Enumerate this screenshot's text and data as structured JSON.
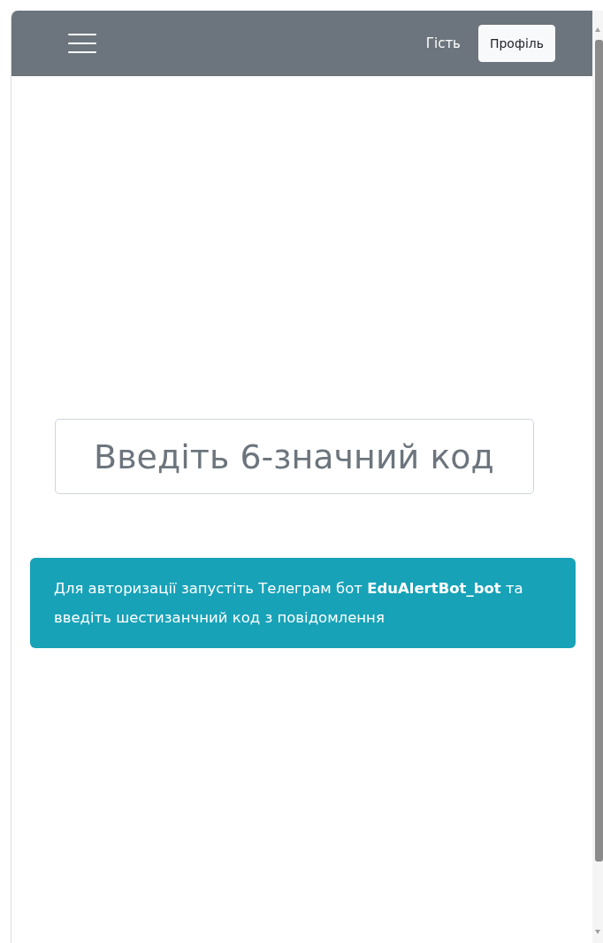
{
  "navbar": {
    "user_label": "Гість",
    "profile_button": "Профіль"
  },
  "code_field": {
    "placeholder": "Введіть 6-значний код"
  },
  "alert": {
    "text": "Для авторизації запустіть Телеграм бот **EduAlertBot_bot** та введіть шестизанчний код з повідомлення"
  }
}
